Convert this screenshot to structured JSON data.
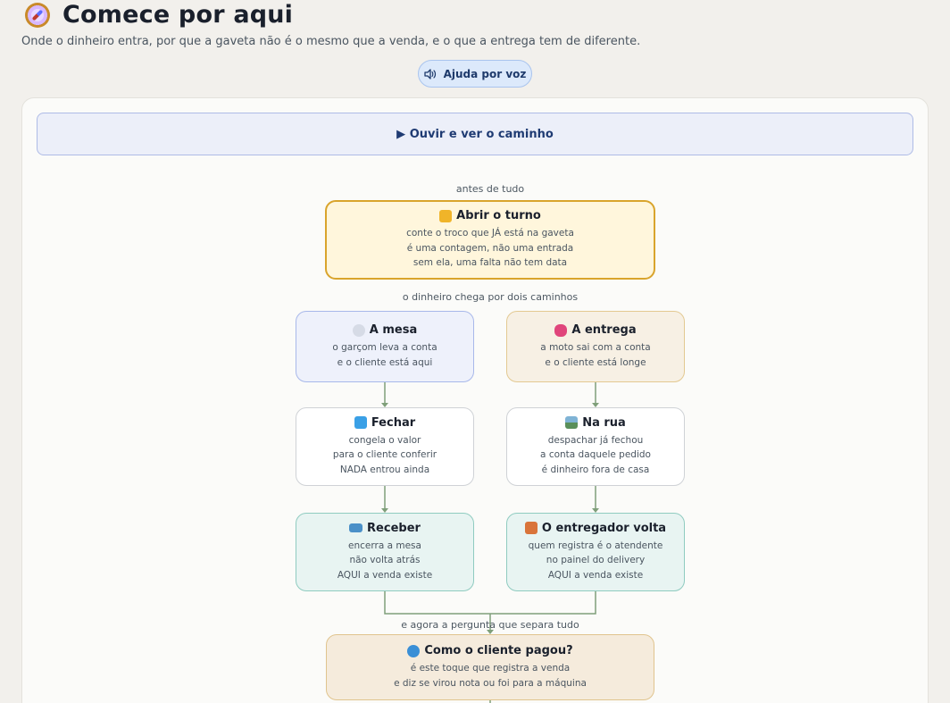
{
  "header": {
    "title": "Comece por aqui",
    "subtitle": "Onde o dinheiro entra, por que a gaveta não é o mesmo que a venda, e o que a entrega tem de diferente.",
    "voice_button": "Ajuda por voz"
  },
  "panel": {
    "play_button": "▶ Ouvir e ver o caminho"
  },
  "flow": {
    "caption_before": "antes de tudo",
    "caption_paths": "o dinheiro chega por dois caminhos",
    "caption_question": "e agora a pergunta que separa tudo",
    "nodes": {
      "turno": {
        "title": "Abrir o turno",
        "icon": "unlock-icon",
        "lines": [
          "conte o troco que JÁ está na gaveta",
          "é uma contagem, não uma entrada",
          "sem ela, uma falta não tem data"
        ]
      },
      "mesa": {
        "title": "A mesa",
        "icon": "plate-icon",
        "lines": [
          "o garçom leva a conta",
          "e o cliente está aqui"
        ]
      },
      "entrega": {
        "title": "A entrega",
        "icon": "scooter-icon",
        "lines": [
          "a moto sai com a conta",
          "e o cliente está longe"
        ]
      },
      "fechar": {
        "title": "Fechar",
        "icon": "cube-icon",
        "lines": [
          "congela o valor",
          "para o cliente conferir",
          "NADA entrou ainda"
        ]
      },
      "narua": {
        "title": "Na rua",
        "icon": "road-icon",
        "lines": [
          "despachar já fechou",
          "a conta daquele pedido",
          "é dinheiro fora de casa"
        ]
      },
      "receber": {
        "title": "Receber",
        "icon": "card-icon",
        "lines": [
          "encerra a mesa",
          "não volta atrás",
          "AQUI a venda existe"
        ]
      },
      "volta": {
        "title": "O entregador volta",
        "icon": "house-icon",
        "lines": [
          "quem registra é o atendente",
          "no painel do delivery",
          "AQUI a venda existe"
        ]
      },
      "pagou": {
        "title": "Como o cliente pagou?",
        "icon": "magnifier-icon",
        "lines": [
          "é este toque que registra a venda",
          "e diz se virou nota ou foi para a máquina"
        ]
      }
    }
  },
  "colors": {
    "connector": "#7f9f7a",
    "accent_gold": "#d9a42c",
    "accent_blue": "#a9c4ee"
  }
}
